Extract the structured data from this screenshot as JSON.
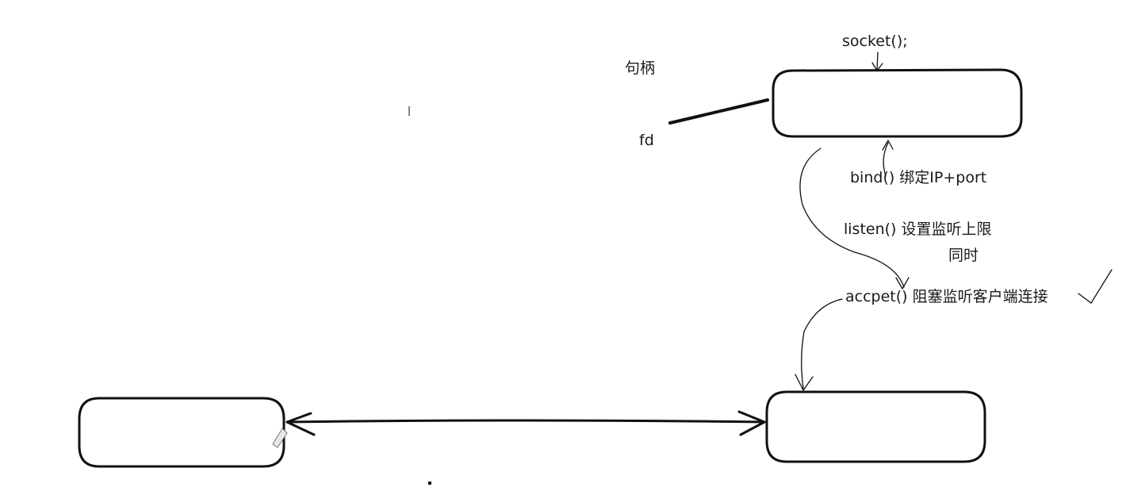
{
  "labels": {
    "socket_call": "socket();",
    "handle": "句柄",
    "fd": "fd",
    "bind": "bind() 绑定IP+port",
    "listen": "listen() 设置监听上限",
    "listen_note": "同时",
    "accept": "accpet() 阻塞监听客户端连接"
  },
  "colors": {
    "ink": "#111111",
    "background": "#ffffff"
  }
}
